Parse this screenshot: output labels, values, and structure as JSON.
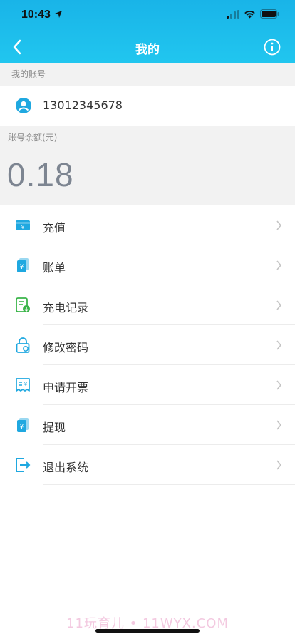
{
  "status_bar": {
    "time": "10:43"
  },
  "nav": {
    "title": "我的"
  },
  "account": {
    "section_label": "我的账号",
    "phone": "13012345678"
  },
  "balance": {
    "label": "账号余额(元)",
    "value": "0.18"
  },
  "menu": [
    {
      "label": "充值",
      "icon": "recharge-card-icon"
    },
    {
      "label": "账单",
      "icon": "bill-yen-icon"
    },
    {
      "label": "充电记录",
      "icon": "charging-record-icon"
    },
    {
      "label": "修改密码",
      "icon": "lock-icon"
    },
    {
      "label": "申请开票",
      "icon": "invoice-icon"
    },
    {
      "label": "提现",
      "icon": "withdraw-yen-icon"
    },
    {
      "label": "退出系统",
      "icon": "logout-icon"
    }
  ],
  "watermark": "11玩育儿 • 11WYX.COM",
  "colors": {
    "header_top": "#19b4e8",
    "header_bottom": "#21c6ef",
    "accent": "#1fa8e0",
    "green": "#3bb54a"
  }
}
